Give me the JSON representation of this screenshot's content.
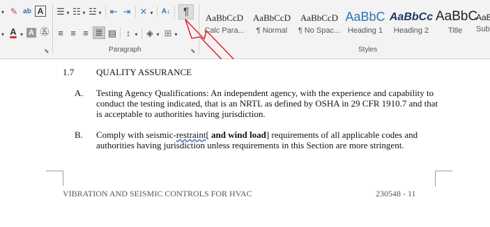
{
  "ribbon": {
    "paragraph_group_label": "Paragraph",
    "styles_group_label": "Styles",
    "paragraph_toggle_glyph": "¶",
    "sort_glyph": "A↓",
    "styles": [
      {
        "preview": "AaBbCcD",
        "name": "Calc Para..."
      },
      {
        "preview": "AaBbCcD",
        "name": "¶ Normal"
      },
      {
        "preview": "AaBbCcD",
        "name": "¶ No Spac..."
      },
      {
        "preview": "AaBbC",
        "name": "Heading 1"
      },
      {
        "preview": "AaBbCc",
        "name": "Heading 2"
      },
      {
        "preview": "AaBbC",
        "name": "Title"
      },
      {
        "preview": "AaBbCc",
        "name": "Subtitle"
      }
    ]
  },
  "annotation": {
    "color": "#e0282e",
    "shape": "arrow-pointing-at-paragraph-toggle"
  },
  "document": {
    "section": {
      "number": "1.7",
      "title": "QUALITY ASSURANCE"
    },
    "items": [
      {
        "letter": "A.",
        "lines": [
          "Testing Agency Qualifications: An independent agency, with the experience and capability to",
          "conduct the testing indicated, that is an NRTL as defined by OSHA in 29 CFR 1910.7 and that",
          "is acceptable to authorities having jurisdiction."
        ]
      },
      {
        "letter": "B.",
        "line1_before": "Comply with seismic-",
        "line1_squiggle": "restraint",
        "line1_bracket": "[",
        "line1_bold": " and wind load",
        "line1_after": "] requirements of all applicable codes and",
        "line2": "authorities having jurisdiction unless requirements in this Section are more stringent."
      }
    ],
    "footer": {
      "left": "VIBRATION AND SEISMIC CONTROLS FOR HVAC",
      "right": "230548 - 11"
    }
  }
}
